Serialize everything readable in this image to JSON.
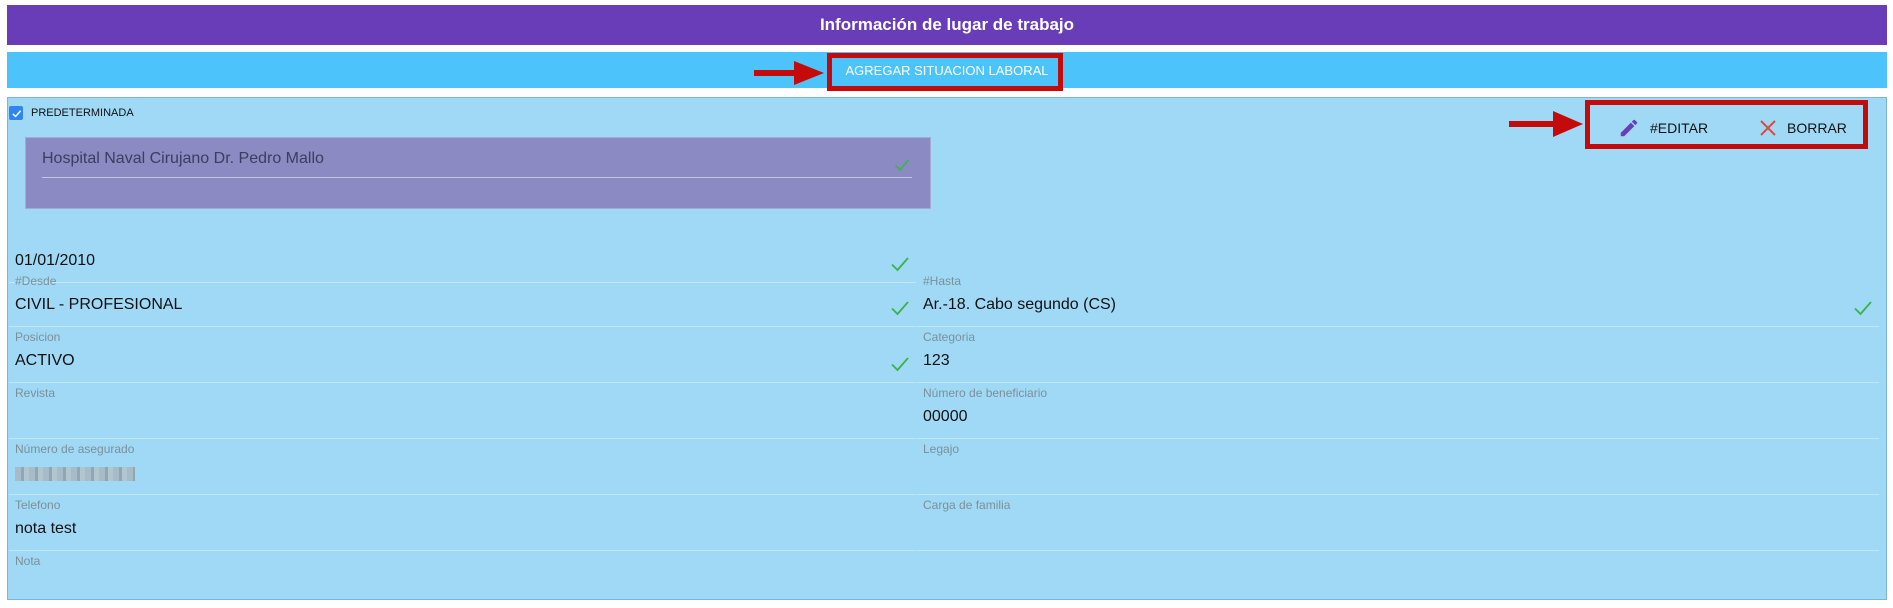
{
  "header": {
    "title": "Información de lugar de trabajo"
  },
  "actions": {
    "add_label": "AGREGAR SITUACION LABORAL"
  },
  "record": {
    "default_label": "PREDETERMINADA",
    "default_checked": true,
    "workplace_name": "Hospital Naval Cirujano Dr. Pedro Mallo",
    "workplace_sub": "",
    "edit_label": "#EDITAR",
    "delete_label": "BORRAR",
    "date_value": "01/01/2010"
  },
  "fields": {
    "desde": {
      "label": "#Desde",
      "value": "CIVIL - PROFESIONAL"
    },
    "hasta": {
      "label": "#Hasta",
      "value": "Ar.-18. Cabo segundo (CS)"
    },
    "posicion": {
      "label": "Posicion",
      "value": "ACTIVO"
    },
    "categoria": {
      "label": "Categoria",
      "value": "123"
    },
    "revista": {
      "label": "Revista",
      "value": ""
    },
    "beneficiario": {
      "label": "Número de beneficiario",
      "value": "00000"
    },
    "asegurado": {
      "label": "Número de asegurado",
      "value": ""
    },
    "legajo": {
      "label": "Legajo",
      "value": ""
    },
    "telefono": {
      "label": "Telefono",
      "value": "nota test"
    },
    "carga": {
      "label": "Carga de familia",
      "value": ""
    },
    "nota": {
      "label": "Nota",
      "value": ""
    }
  },
  "colors": {
    "header_bg": "#6a3db8",
    "action_bar_bg": "#4cc3fb",
    "panel_bg": "#a0d9f5",
    "workplace_bg": "#8b8ac2",
    "check_green": "#3cb34a",
    "highlight_red": "#c40a0a"
  },
  "icons": [
    "check-icon",
    "pencil-icon",
    "close-icon",
    "arrow-right-icon"
  ]
}
